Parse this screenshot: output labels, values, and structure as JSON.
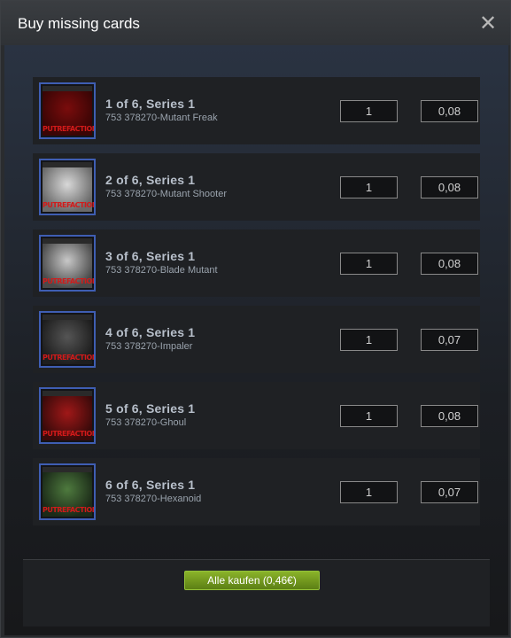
{
  "dialog": {
    "title": "Buy missing cards",
    "close_glyph": "✕"
  },
  "cards": [
    {
      "title": "1 of 6, Series 1",
      "subtitle": "753 378270-Mutant Freak",
      "quantity": "1",
      "price": "0,08",
      "art_colors": [
        "#7a0c0c",
        "#3a0505"
      ],
      "icon": "mutant-freak-card-icon"
    },
    {
      "title": "2 of 6, Series 1",
      "subtitle": "753 378270-Mutant Shooter",
      "quantity": "1",
      "price": "0,08",
      "art_colors": [
        "#d8d8d8",
        "#6a6a6a"
      ],
      "icon": "mutant-shooter-card-icon"
    },
    {
      "title": "3 of 6, Series 1",
      "subtitle": "753 378270-Blade Mutant",
      "quantity": "1",
      "price": "0,08",
      "art_colors": [
        "#c8c8c8",
        "#4a4a4a"
      ],
      "icon": "blade-mutant-card-icon"
    },
    {
      "title": "4 of 6, Series 1",
      "subtitle": "753 378270-Impaler",
      "quantity": "1",
      "price": "0,07",
      "art_colors": [
        "#555555",
        "#1e1e1e"
      ],
      "icon": "impaler-card-icon"
    },
    {
      "title": "5 of 6, Series 1",
      "subtitle": "753 378270-Ghoul",
      "quantity": "1",
      "price": "0,08",
      "art_colors": [
        "#a01818",
        "#3a0a0a"
      ],
      "icon": "ghoul-card-icon"
    },
    {
      "title": "6 of 6, Series 1",
      "subtitle": "753 378270-Hexanoid",
      "quantity": "1",
      "price": "0,07",
      "art_colors": [
        "#4e7a3e",
        "#1b2a18"
      ],
      "icon": "hexanoid-card-icon"
    }
  ],
  "card_logo_text": "PUTREFACTION",
  "footer": {
    "buy_all_label": "Alle kaufen (0,46€)"
  },
  "colors": {
    "accent_green": "#7aa626",
    "card_border": "#3f5eb3"
  }
}
